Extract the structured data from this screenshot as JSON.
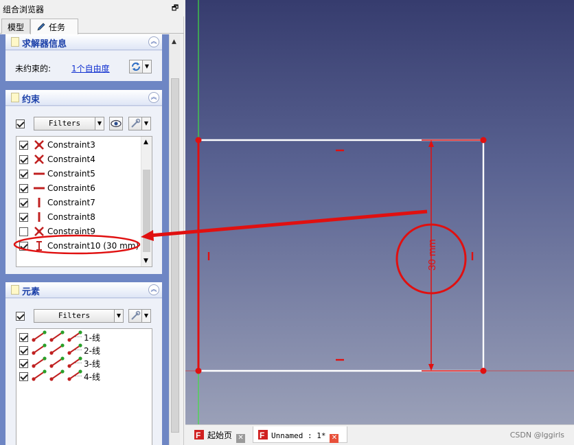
{
  "combo_view": {
    "title": "组合浏览器",
    "float_glyph": "🗗",
    "tabs": [
      {
        "label": "模型"
      },
      {
        "label": "任务"
      }
    ]
  },
  "solver_panel": {
    "title": "求解器信息",
    "unconstrained_label": "未约束的:",
    "dof_link": "1个自由度"
  },
  "constraints_panel": {
    "title": "约束",
    "filter_label": "Filters",
    "items": [
      {
        "label": "Constraint3",
        "checked": true,
        "icon": "coincident-icon"
      },
      {
        "label": "Constraint4",
        "checked": true,
        "icon": "coincident-icon"
      },
      {
        "label": "Constraint5",
        "checked": true,
        "icon": "horizontal-icon"
      },
      {
        "label": "Constraint6",
        "checked": true,
        "icon": "horizontal-icon"
      },
      {
        "label": "Constraint7",
        "checked": true,
        "icon": "vertical-icon"
      },
      {
        "label": "Constraint8",
        "checked": true,
        "icon": "vertical-icon"
      },
      {
        "label": "Constraint9",
        "checked": false,
        "icon": "coincident-icon"
      },
      {
        "label": "Constraint10 (30 mm)",
        "checked": true,
        "icon": "vertical-distance-icon"
      }
    ]
  },
  "elements_panel": {
    "title": "元素",
    "filter_label": "Filters",
    "items": [
      {
        "label": "1-线",
        "checked": true
      },
      {
        "label": "2-线",
        "checked": true
      },
      {
        "label": "3-线",
        "checked": true
      },
      {
        "label": "4-线",
        "checked": true
      }
    ]
  },
  "viewport": {
    "dimension_label": "30 mm",
    "colors": {
      "constraint": "#e01010",
      "geometry": "#ffffff",
      "x_axis": "#d04040",
      "y_axis": "#40e040"
    }
  },
  "doc_tabs": [
    {
      "label": "起始页"
    },
    {
      "label": "Unnamed : 1*"
    }
  ],
  "watermark": "CSDN @lggirls"
}
